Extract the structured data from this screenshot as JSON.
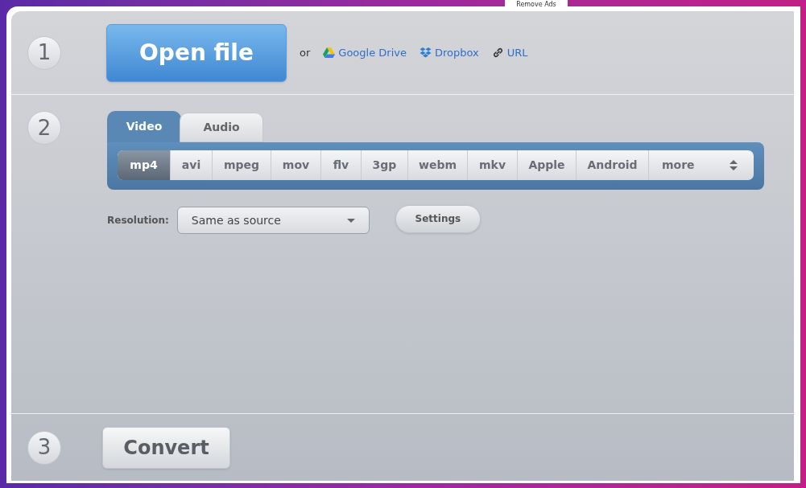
{
  "top_link": "Remove Ads",
  "steps": [
    {
      "number": "1"
    },
    {
      "number": "2"
    },
    {
      "number": "3"
    }
  ],
  "open_file": {
    "label": "Open file",
    "or": "or",
    "sources": [
      {
        "kind": "drive",
        "label": "Google Drive"
      },
      {
        "kind": "dropbox",
        "label": "Dropbox"
      },
      {
        "kind": "url",
        "label": "URL"
      }
    ]
  },
  "tabs": [
    {
      "label": "Video",
      "selected": true
    },
    {
      "label": "Audio",
      "selected": false
    }
  ],
  "formats": [
    {
      "label": "mp4",
      "selected": true
    },
    {
      "label": "avi",
      "selected": false
    },
    {
      "label": "mpeg",
      "selected": false
    },
    {
      "label": "mov",
      "selected": false
    },
    {
      "label": "flv",
      "selected": false
    },
    {
      "label": "3gp",
      "selected": false
    },
    {
      "label": "webm",
      "selected": false
    },
    {
      "label": "mkv",
      "selected": false
    },
    {
      "label": "Apple",
      "selected": false
    },
    {
      "label": "Android",
      "selected": false
    },
    {
      "label": "more",
      "selected": false
    }
  ],
  "resolution": {
    "label": "Resolution:",
    "value": "Same as source"
  },
  "settings_button": "Settings",
  "convert_button": "Convert"
}
